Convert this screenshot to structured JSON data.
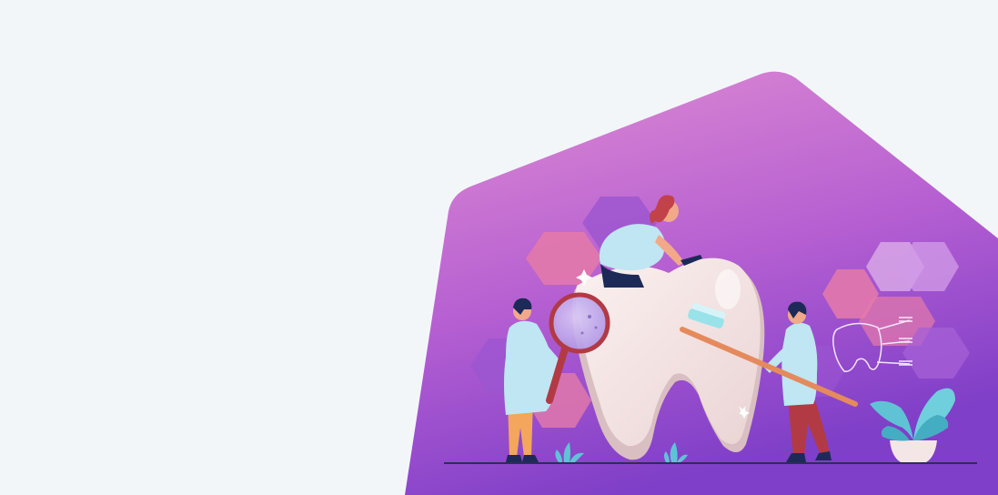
{
  "page": {
    "background_color": "#f3f6f9"
  },
  "hero_banner": {
    "illustration": "dental-care-illustration",
    "colors": {
      "gradient_top": "#e08ed3",
      "gradient_mid": "#b65fd2",
      "gradient_bottom": "#7f3fc8",
      "hexagon_pink": "#e57aa9",
      "hexagon_violet": "#9b55d0",
      "tooth": "#f4e6e6",
      "tooth_shadow": "#d9bfc2",
      "coat": "#bfe6f2",
      "hair": "#1d2a57",
      "magnifier_frame": "#b23a45",
      "toothbrush_handle": "#e58a5c",
      "plant_leaf": "#5fc3d5",
      "ground_line": "#2b2d5a"
    }
  }
}
